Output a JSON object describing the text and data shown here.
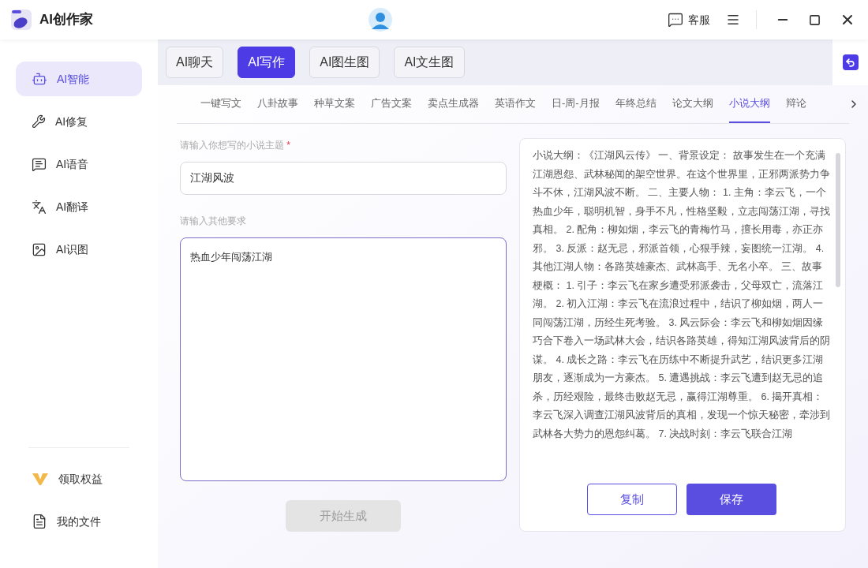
{
  "app": {
    "title": "AI创作家",
    "support": "客服"
  },
  "sidebar": {
    "items": [
      {
        "label": "AI智能",
        "selected": true
      },
      {
        "label": "AI修复",
        "selected": false
      },
      {
        "label": "AI语音",
        "selected": false
      },
      {
        "label": "AI翻译",
        "selected": false
      },
      {
        "label": "AI识图",
        "selected": false
      }
    ],
    "bottom_items": [
      {
        "label": "领取权益"
      },
      {
        "label": "我的文件"
      }
    ]
  },
  "main_tabs": [
    {
      "label": "AI聊天",
      "selected": false
    },
    {
      "label": "AI写作",
      "selected": true
    },
    {
      "label": "AI图生图",
      "selected": false
    },
    {
      "label": "AI文生图",
      "selected": false
    }
  ],
  "sub_tabs": [
    {
      "label": "一键写文",
      "selected": false
    },
    {
      "label": "八卦故事",
      "selected": false
    },
    {
      "label": "种草文案",
      "selected": false
    },
    {
      "label": "广告文案",
      "selected": false
    },
    {
      "label": "卖点生成器",
      "selected": false
    },
    {
      "label": "英语作文",
      "selected": false
    },
    {
      "label": "日-周-月报",
      "selected": false
    },
    {
      "label": "年终总结",
      "selected": false
    },
    {
      "label": "论文大纲",
      "selected": false
    },
    {
      "label": "小说大纲",
      "selected": true
    },
    {
      "label": "辩论",
      "selected": false
    }
  ],
  "form": {
    "topic_label": "请输入你想写的小说主题",
    "required_mark": "*",
    "topic_value": "江湖风波",
    "other_label": "请输入其他要求",
    "other_value": "热血少年闯荡江湖",
    "generate_button": {
      "label": "开始生成",
      "disabled": true
    }
  },
  "result": {
    "text": "小说大纲：《江湖风云传》 一、背景设定： 故事发生在一个充满江湖恩怨、武林秘闻的架空世界。在这个世界里，正邪两派势力争斗不休，江湖风波不断。 二、主要人物： 1. 主角：李云飞，一个热血少年，聪明机智，身手不凡，性格坚毅，立志闯荡江湖，寻找真相。 2. 配角：柳如烟，李云飞的青梅竹马，擅长用毒，亦正亦邪。 3. 反派：赵无忌，邪派首领，心狠手辣，妄图统一江湖。 4. 其他江湖人物：各路英雄豪杰、武林高手、无名小卒。 三、故事梗概： 1. 引子：李云飞在家乡遭受邪派袭击，父母双亡，流落江湖。 2. 初入江湖：李云飞在流浪过程中，结识了柳如烟，两人一同闯荡江湖，历经生死考验。 3. 风云际会：李云飞和柳如烟因缘巧合下卷入一场武林大会，结识各路英雄，得知江湖风波背后的阴谋。 4. 成长之路：李云飞在历练中不断提升武艺，结识更多江湖朋友，逐渐成为一方豪杰。 5. 遭遇挑战：李云飞遭到赵无忌的追杀，历经艰险，最终击败赵无忌，赢得江湖尊重。 6. 揭开真相：李云飞深入调查江湖风波背后的真相，发现一个惊天秘密，牵涉到武林各大势力的恩怨纠葛。 7. 决战时刻：李云飞联合江湖",
    "buttons": [
      {
        "label": "复制",
        "kind": "outline"
      },
      {
        "label": "保存",
        "kind": "primary"
      }
    ]
  }
}
